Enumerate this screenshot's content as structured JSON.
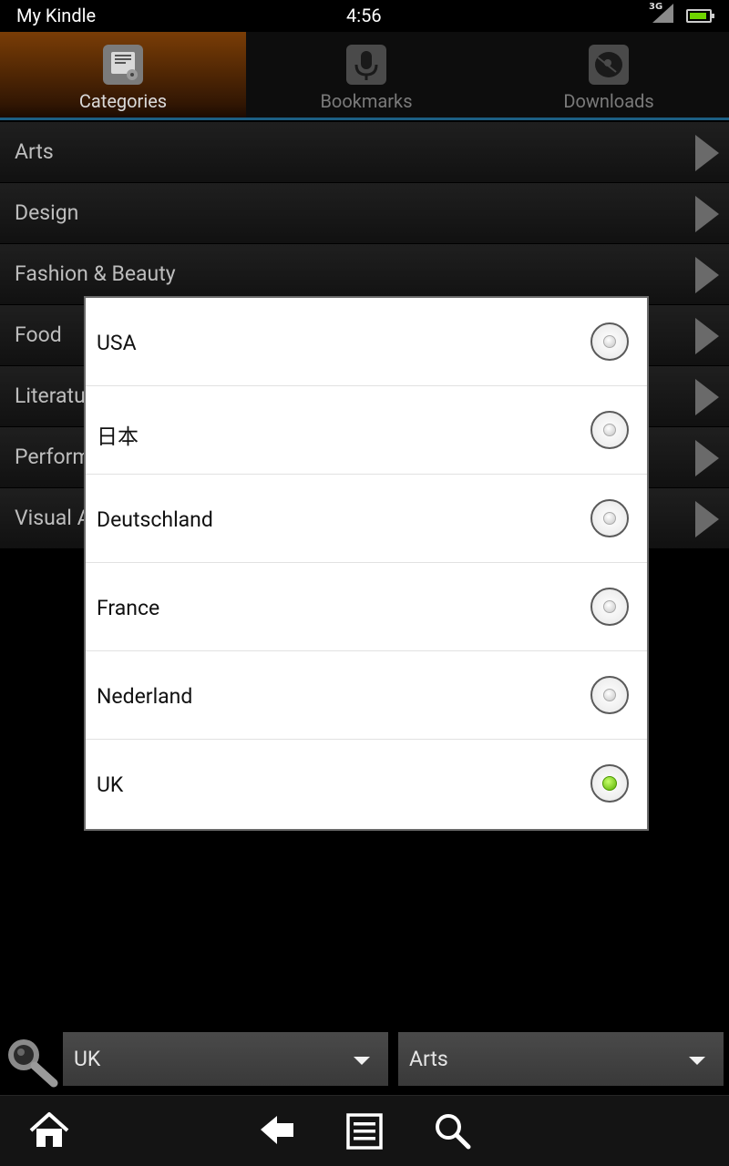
{
  "status_bar": {
    "app_name": "My Kindle",
    "time": "4:56",
    "network": "3G",
    "battery_level": 0.9
  },
  "tabs": [
    {
      "label": "Categories",
      "icon": "archive-icon",
      "active": true
    },
    {
      "label": "Bookmarks",
      "icon": "microphone-icon",
      "active": false
    },
    {
      "label": "Downloads",
      "icon": "disc-icon",
      "active": false
    }
  ],
  "categories": [
    {
      "label": "Arts"
    },
    {
      "label": "Design"
    },
    {
      "label": "Fashion & Beauty"
    },
    {
      "label": "Food"
    },
    {
      "label": "Literature"
    },
    {
      "label": "Performing Arts"
    },
    {
      "label": "Visual Arts"
    }
  ],
  "dialog": {
    "options": [
      {
        "label": "USA",
        "selected": false
      },
      {
        "label": "日本",
        "selected": false
      },
      {
        "label": "Deutschland",
        "selected": false
      },
      {
        "label": "France",
        "selected": false
      },
      {
        "label": "Nederland",
        "selected": false
      },
      {
        "label": "UK",
        "selected": true
      }
    ]
  },
  "filters": {
    "search_icon": "search-icon",
    "region": "UK",
    "category": "Arts"
  },
  "nav": {
    "icons": [
      "home-icon",
      "back-icon",
      "menu-icon",
      "search-icon"
    ]
  },
  "colors": {
    "active_tab": "#7a3d06",
    "tab_underline": "#1c5f84",
    "radio_selected": "#58b000"
  }
}
